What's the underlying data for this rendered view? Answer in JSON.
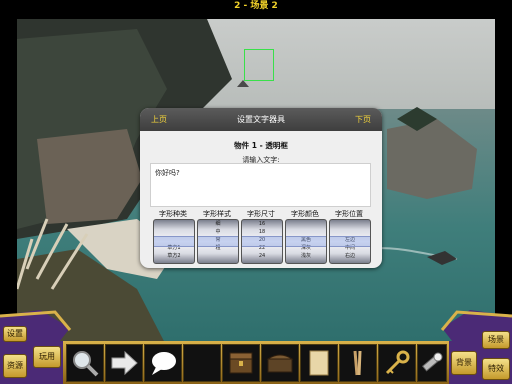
{
  "header": {
    "title": "2 - 场景 2"
  },
  "dialog": {
    "prev_label": "上页",
    "title": "设置文字器具",
    "next_label": "下页",
    "object_title": "物件 1 - 透明框",
    "prompt": "请输入文字:",
    "input_value": "你好吗?",
    "columns": [
      {
        "label": "字形种类",
        "options": [
          "",
          "",
          "",
          "草方1",
          "草方2"
        ]
      },
      {
        "label": "字形样式",
        "options": [
          "细",
          "中",
          "常",
          "粗",
          ""
        ]
      },
      {
        "label": "字形尺寸",
        "options": [
          "16",
          "18",
          "20",
          "22",
          "24"
        ]
      },
      {
        "label": "字形颜色",
        "options": [
          "",
          "",
          "黑色",
          "深灰",
          "浅灰"
        ]
      },
      {
        "label": "字形位置",
        "options": [
          "",
          "",
          "左边",
          "中间",
          "右边"
        ]
      }
    ]
  },
  "toolbar": {
    "settings_label": "设置",
    "assets_label": "资源",
    "play_label": "玩用",
    "scene_label": "场景",
    "background_label": "背景",
    "effects_label": "特效"
  },
  "icons": [
    "magnifier-icon",
    "arrow-right-icon",
    "speech-bubble-icon",
    "empty-slot-icon",
    "treasure-chest-icon",
    "chest-icon",
    "scroll-icon",
    "sticks-icon",
    "key-icon",
    "flashlight-icon"
  ]
}
